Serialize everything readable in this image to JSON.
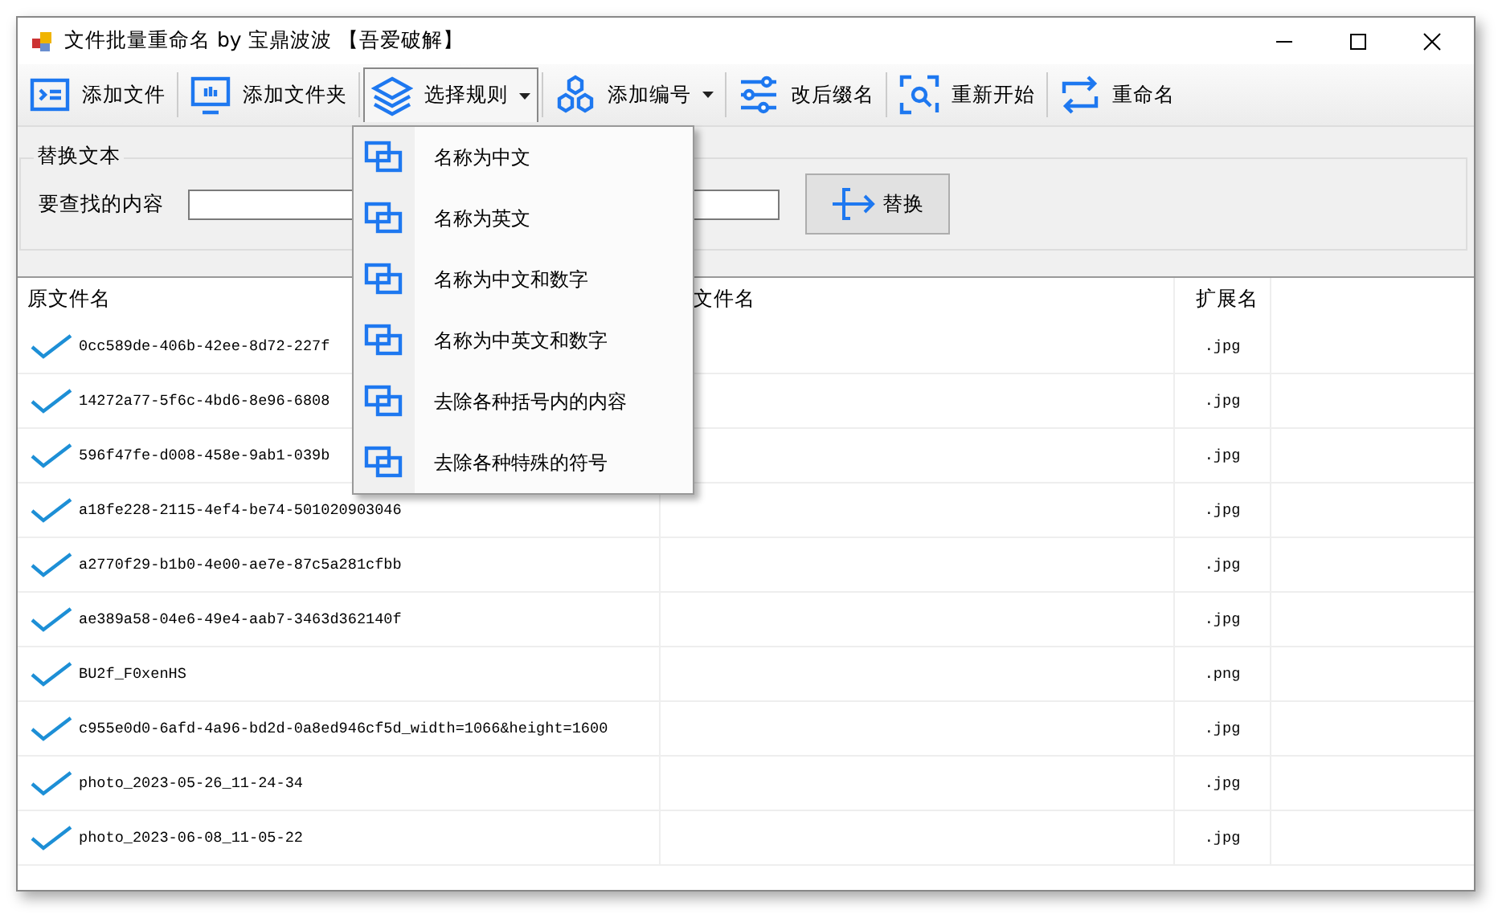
{
  "window": {
    "title": "文件批量重命名 by 宝鼎波波 【吾爱破解】"
  },
  "toolbar": [
    {
      "label": "添加文件",
      "dropdown": false,
      "open": false
    },
    {
      "label": "添加文件夹",
      "dropdown": false,
      "open": false
    },
    {
      "label": "选择规则",
      "dropdown": true,
      "open": true
    },
    {
      "label": "添加编号",
      "dropdown": true,
      "open": false
    },
    {
      "label": "改后缀名",
      "dropdown": false,
      "open": false
    },
    {
      "label": "重新开始",
      "dropdown": false,
      "open": false
    },
    {
      "label": "重命名",
      "dropdown": false,
      "open": false
    }
  ],
  "rules_menu": [
    "名称为中文",
    "名称为英文",
    "名称为中文和数字",
    "名称为中英文和数字",
    "去除各种括号内的内容",
    "去除各种特殊的符号"
  ],
  "replace_group": {
    "title": "替换文本",
    "find_label": "要查找的内容",
    "button": "替换"
  },
  "table": {
    "columns": [
      "原文件名",
      "文件名",
      "扩展名"
    ],
    "rows": [
      {
        "checked": true,
        "name": "0cc589de-406b-42ee-8d72-227f",
        "ext": ".jpg"
      },
      {
        "checked": true,
        "name": "14272a77-5f6c-4bd6-8e96-6808",
        "ext": ".jpg"
      },
      {
        "checked": true,
        "name": "596f47fe-d008-458e-9ab1-039b",
        "ext": ".jpg"
      },
      {
        "checked": true,
        "name": "a18fe228-2115-4ef4-be74-501020903046",
        "ext": ".jpg"
      },
      {
        "checked": true,
        "name": "a2770f29-b1b0-4e00-ae7e-87c5a281cfbb",
        "ext": ".jpg"
      },
      {
        "checked": true,
        "name": "ae389a58-04e6-49e4-aab7-3463d362140f",
        "ext": ".jpg"
      },
      {
        "checked": true,
        "name": "BU2f_F0xenHS",
        "ext": ".png"
      },
      {
        "checked": true,
        "name": "c955e0d0-6afd-4a96-bd2d-0a8ed946cf5d_width=1066&height=1600",
        "ext": ".jpg"
      },
      {
        "checked": true,
        "name": "photo_2023-05-26_11-24-34",
        "ext": ".jpg"
      },
      {
        "checked": true,
        "name": "photo_2023-06-08_11-05-22",
        "ext": ".jpg"
      }
    ]
  }
}
